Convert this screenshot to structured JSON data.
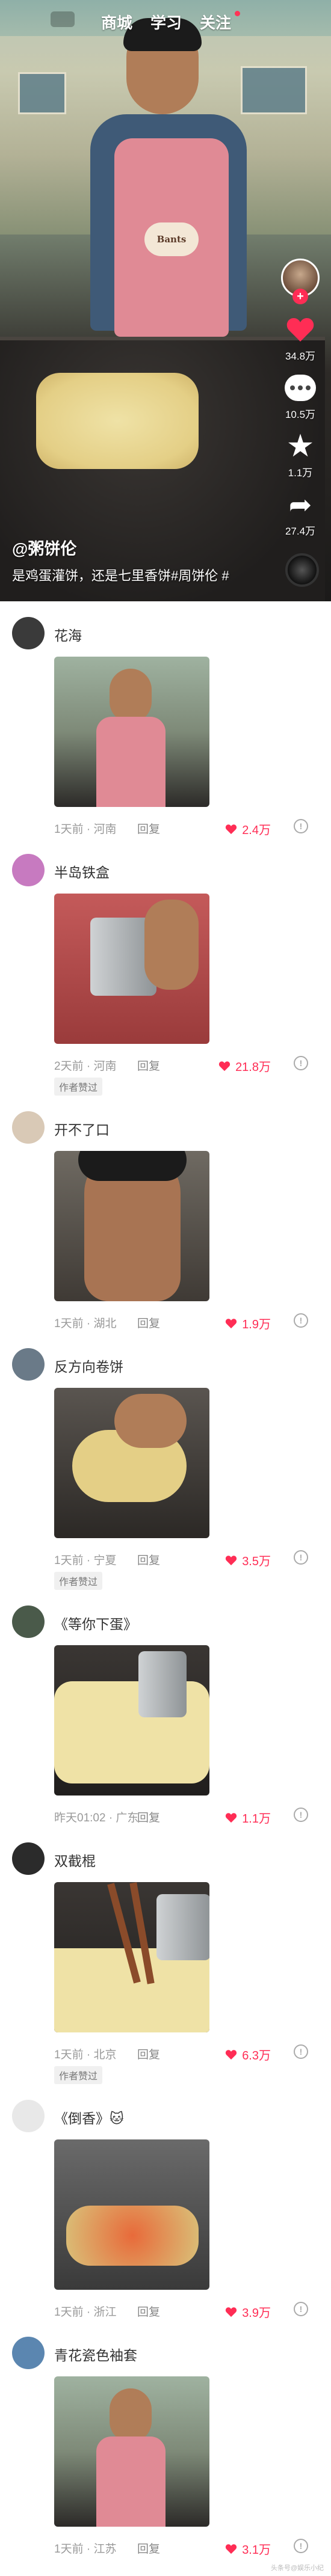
{
  "topnav": {
    "tabs": [
      "商城",
      "学习",
      "关注"
    ],
    "active_tab": "关注"
  },
  "rail": {
    "likes": "34.8万",
    "comments": "10.5万",
    "favorites": "1.1万",
    "shares": "27.4万"
  },
  "caption": {
    "author": "@粥饼伦",
    "description": "是鸡蛋灌饼，还是七里香饼#周饼伦 #"
  },
  "apron_text": "Bants",
  "comments": [
    {
      "name": "花海",
      "when": "1天前 · 河南",
      "reply": "回复",
      "likes": "2.4万",
      "badge": "",
      "avatar_color": "#3a3a3a",
      "thumb": "person"
    },
    {
      "name": "半岛铁盒",
      "when": "2天前 · 河南",
      "reply": "回复",
      "likes": "21.8万",
      "badge": "作者赞过",
      "avatar_color": "#c77ac0",
      "thumb": "cup"
    },
    {
      "name": "开不了口",
      "when": "1天前 · 湖北",
      "reply": "回复",
      "likes": "1.9万",
      "badge": "",
      "avatar_color": "#d9c9b6",
      "thumb": "face"
    },
    {
      "name": "反方向卷饼",
      "when": "1天前 · 宁夏",
      "reply": "回复",
      "likes": "3.5万",
      "badge": "作者赞过",
      "avatar_color": "#6a7a88",
      "thumb": "roll"
    },
    {
      "name": "《等你下蛋》",
      "when": "昨天01:02 · 广东",
      "reply": "回复",
      "likes": "1.1万",
      "badge": "",
      "avatar_color": "#4a5a4a",
      "thumb": "egg"
    },
    {
      "name": "双截棍",
      "when": "1天前 · 北京",
      "reply": "回复",
      "likes": "6.3万",
      "badge": "作者赞过",
      "avatar_color": "#2b2b2b",
      "thumb": "sticks"
    },
    {
      "name": "《倒香》🐱",
      "when": "1天前 · 浙江",
      "reply": "回复",
      "likes": "3.9万",
      "badge": "",
      "avatar_color": "#e8e8e8",
      "thumb": "noodle"
    },
    {
      "name": "青花瓷色袖套",
      "when": "1天前 · 江苏",
      "reply": "回复",
      "likes": "3.1万",
      "badge": "",
      "avatar_color": "#5b86b0",
      "thumb": "person"
    }
  ],
  "colors": {
    "accent": "#ff2d55",
    "meta_gray": "#999999"
  },
  "watermark": "头条号@娱乐小纪"
}
